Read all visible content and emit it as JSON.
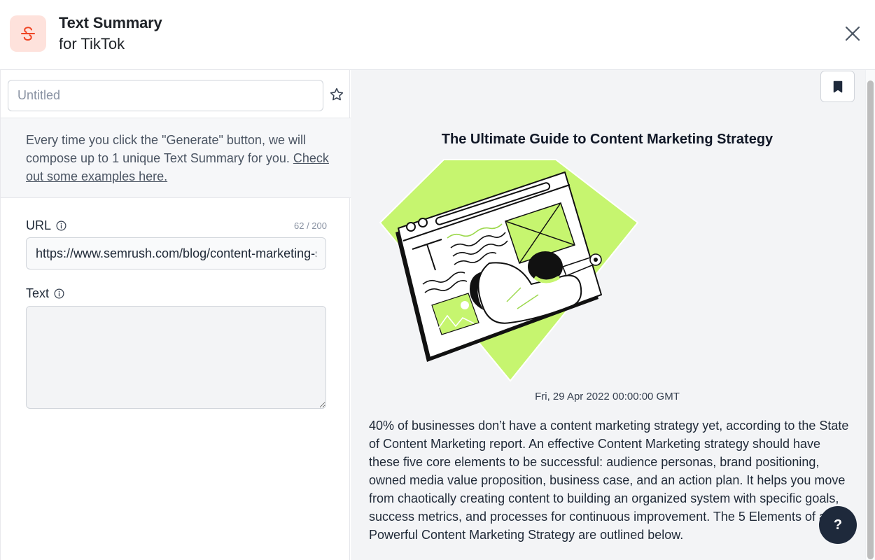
{
  "header": {
    "title": "Text Summary",
    "subtitle": "for TikTok",
    "logo_icon": "strikethrough-s-icon",
    "close_icon": "close-icon"
  },
  "left_panel": {
    "name_input": {
      "value": "",
      "placeholder": "Untitled"
    },
    "favorite_icon": "star-outline-icon",
    "info": {
      "text": "Every time you click the \"Generate\" button, we will compose up to 1 unique Text Summary for you. ",
      "link_label": "Check out some examples here."
    },
    "url_field": {
      "label": "URL",
      "counter": "62 / 200",
      "value": "https://www.semrush.com/blog/content-marketing-strategy-guide/"
    },
    "text_field": {
      "label": "Text",
      "value": ""
    }
  },
  "right_panel": {
    "bookmark_icon": "bookmark-icon",
    "article_title": "The Ultimate Guide to Content Marketing Strategy",
    "date": "Fri, 29 Apr 2022 00:00:00 GMT",
    "summary": "40% of businesses don’t have a content marketing strategy yet, according to the State of Content Marketing report. An effective Content Marketing strategy should have these five core elements to be successful: audience personas, brand positioning, owned media value proposition, business case, and an action plan. It helps you move from chaotically creating content to building an organized system with specific goals, success metrics, and processes for continuous improvement. The 5 Elements of a Powerful Content Marketing Strategy are outlined below."
  },
  "help_button": {
    "label": "?"
  },
  "colors": {
    "brand_accent": "#ef4423",
    "logo_bg": "#fee2dc",
    "illustration_green": "#c6f56f",
    "help_button_bg": "#1e293b"
  }
}
